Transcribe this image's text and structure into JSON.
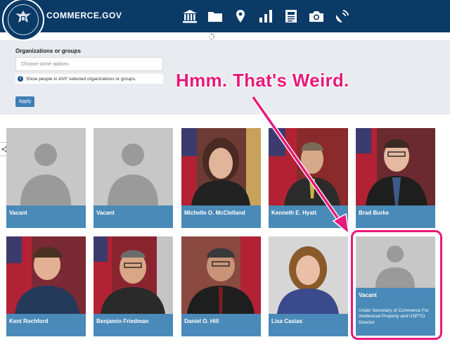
{
  "header": {
    "site_title": "COMMERCE.GOV",
    "seal_top_text": "DEPARTMENT OF COMMERCE",
    "seal_bottom_text": "UNITED STATES OF AMERICA",
    "nav_icons": [
      "bank-icon",
      "folder-icon",
      "map-pin-icon",
      "bar-chart-icon",
      "newspaper-icon",
      "camera-icon",
      "satellite-icon"
    ]
  },
  "filter": {
    "label": "Organizations or groups",
    "placeholder": "Choose some options",
    "hint": "Show people in ANY selected organizations or groups.",
    "apply_label": "Apply"
  },
  "annotation": {
    "text": "Hmm. That's Weird.",
    "color": "#e8197a"
  },
  "people": [
    {
      "name": "Vacant",
      "vacant": true
    },
    {
      "name": "Vacant",
      "vacant": true
    },
    {
      "name": "Michelle O. McClelland",
      "vacant": false
    },
    {
      "name": "Kenneth E. Hyatt",
      "vacant": false
    },
    {
      "name": "Brad Burke",
      "vacant": false
    },
    {
      "name": "Kent Rochford",
      "vacant": false
    },
    {
      "name": "Benjamin Friedman",
      "vacant": false
    },
    {
      "name": "Daniel O. Hill",
      "vacant": false
    },
    {
      "name": "Lisa Casias",
      "vacant": false
    },
    {
      "name": "Vacant",
      "vacant": true,
      "title": "Under Secretary of Commerce For Intellectual Property and USPTO Director"
    }
  ],
  "colors": {
    "header_bg": "#0b3a67",
    "card_bar": "#4a8ab8",
    "panel_bg": "#e8ecf0"
  }
}
